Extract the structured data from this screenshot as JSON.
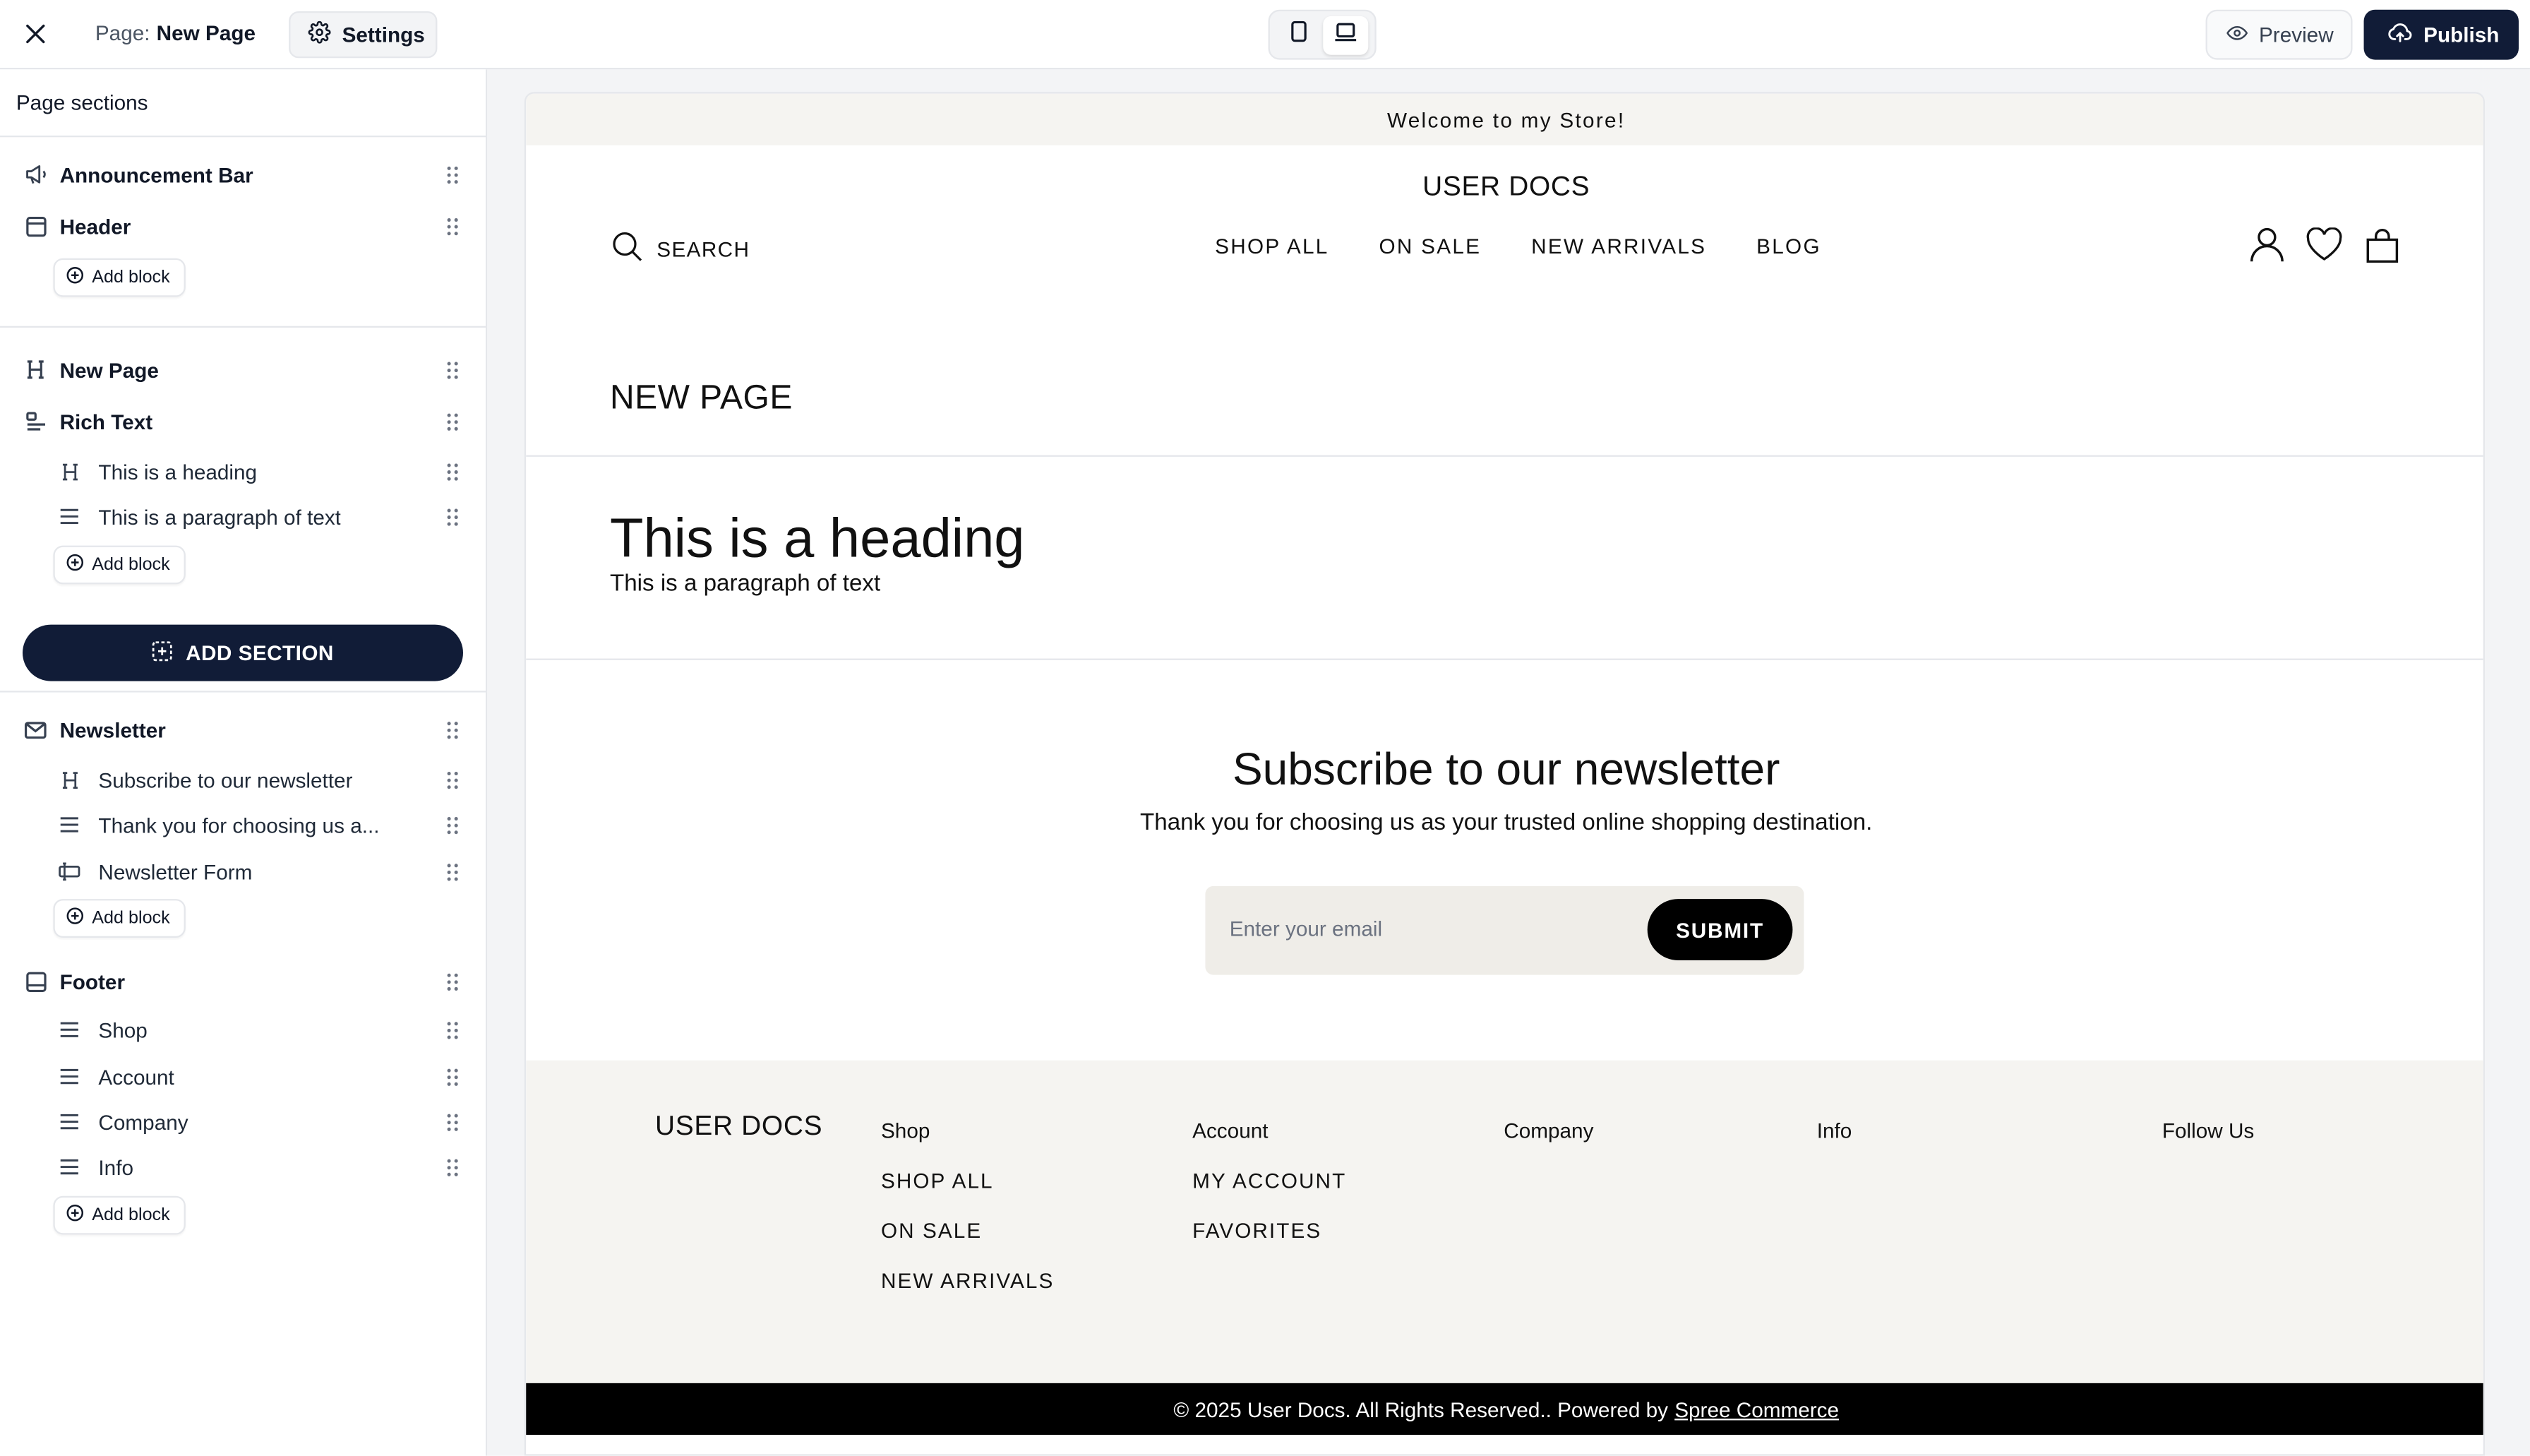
{
  "topbar": {
    "page_label": "Page:",
    "page_name": "New Page",
    "settings_label": "Settings",
    "preview_label": "Preview",
    "publish_label": "Publish",
    "devices": [
      "mobile-icon",
      "desktop-icon"
    ],
    "active_device": "desktop"
  },
  "sidebar": {
    "title": "Page sections",
    "add_block_label": "Add block",
    "add_section_label": "ADD SECTION",
    "sections": {
      "announcement": "Announcement Bar",
      "header": "Header",
      "new_page": "New Page",
      "rich_text": "Rich Text",
      "rich_text_blocks": [
        "This is a heading",
        "This is a paragraph of text"
      ],
      "newsletter": "Newsletter",
      "newsletter_blocks": [
        "Subscribe to our newsletter",
        "Thank you for choosing us a...",
        "Newsletter Form"
      ],
      "footer": "Footer",
      "footer_blocks": [
        "Shop",
        "Account",
        "Company",
        "Info"
      ]
    }
  },
  "preview": {
    "announcement": "Welcome to my Store!",
    "store_name": "USER DOCS",
    "search_label": "SEARCH",
    "nav": [
      "SHOP ALL",
      "ON SALE",
      "NEW ARRIVALS",
      "BLOG"
    ],
    "page_title": "NEW PAGE",
    "rich_heading": "This is a heading",
    "rich_paragraph": "This is a paragraph of text",
    "newsletter_heading": "Subscribe to our newsletter",
    "newsletter_text": "Thank you for choosing us as your trusted online shopping destination.",
    "email_placeholder": "Enter your email",
    "submit_label": "SUBMIT",
    "footer": {
      "logo": "USER DOCS",
      "shop_title": "Shop",
      "shop_links": [
        "SHOP ALL",
        "ON SALE",
        "NEW ARRIVALS"
      ],
      "account_title": "Account",
      "account_links": [
        "MY ACCOUNT",
        "FAVORITES"
      ],
      "company_title": "Company",
      "info_title": "Info",
      "follow_title": "Follow Us",
      "copyright": "© 2025 User Docs. All Rights Reserved..  Powered by",
      "powered_link": "Spree Commerce"
    }
  },
  "colors": {
    "primary": "#111c37",
    "announcement_bg": "#f5f4f1",
    "footer_bottom_bg": "#000000"
  }
}
